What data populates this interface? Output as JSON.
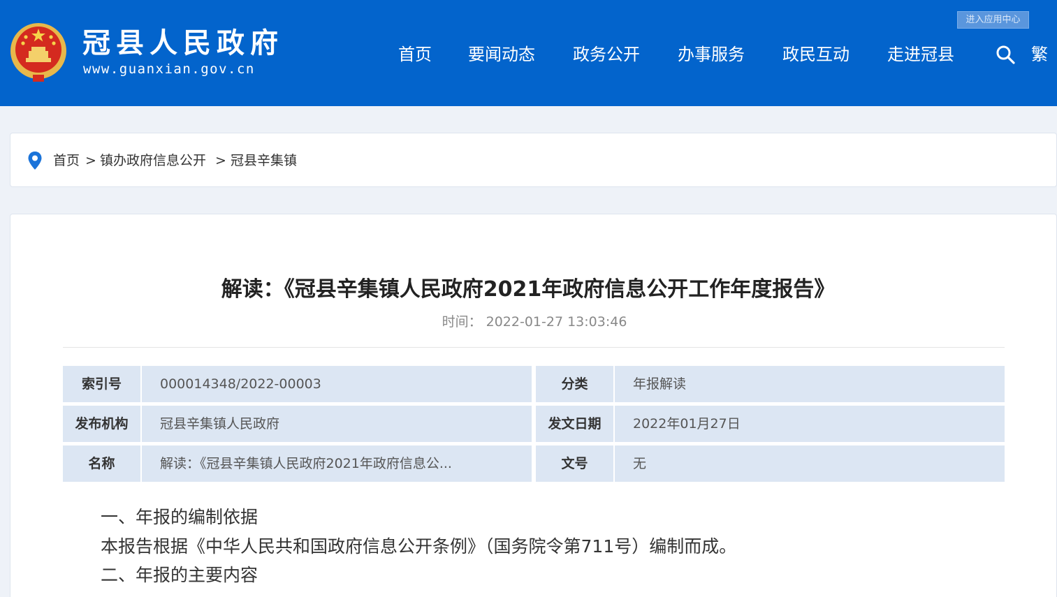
{
  "header": {
    "site_name": "冠县人民政府",
    "site_url": "www.guanxian.gov.cn",
    "app_center_label": "进入应用中心",
    "nav": [
      "首页",
      "要闻动态",
      "政务公开",
      "办事服务",
      "政民互动",
      "走进冠县"
    ],
    "traditional_label": "繁",
    "brand_color": "#0364cc"
  },
  "breadcrumb": {
    "items": [
      "首页",
      "镇办政府信息公开",
      "冠县辛集镇"
    ],
    "separator": ">"
  },
  "article": {
    "title": "解读：《冠县辛集镇人民政府2021年政府信息公开工作年度报告》",
    "time_label": "时间：",
    "time_value": "2022-01-27 13:03:46",
    "meta": [
      {
        "label": "索引号",
        "value": "000014348/2022-00003",
        "label2": "分类",
        "value2": "年报解读"
      },
      {
        "label": "发布机构",
        "value": "冠县辛集镇人民政府",
        "label2": "发文日期",
        "value2": "2022年01月27日"
      },
      {
        "label": "名称",
        "value": "解读：《冠县辛集镇人民政府2021年政府信息公...",
        "label2": "文号",
        "value2": "无"
      }
    ],
    "paragraphs": [
      "一、年报的编制依据",
      "本报告根据《中华人民共和国政府信息公开条例》（国务院令第711号）编制而成。",
      "二、年报的主要内容"
    ]
  }
}
